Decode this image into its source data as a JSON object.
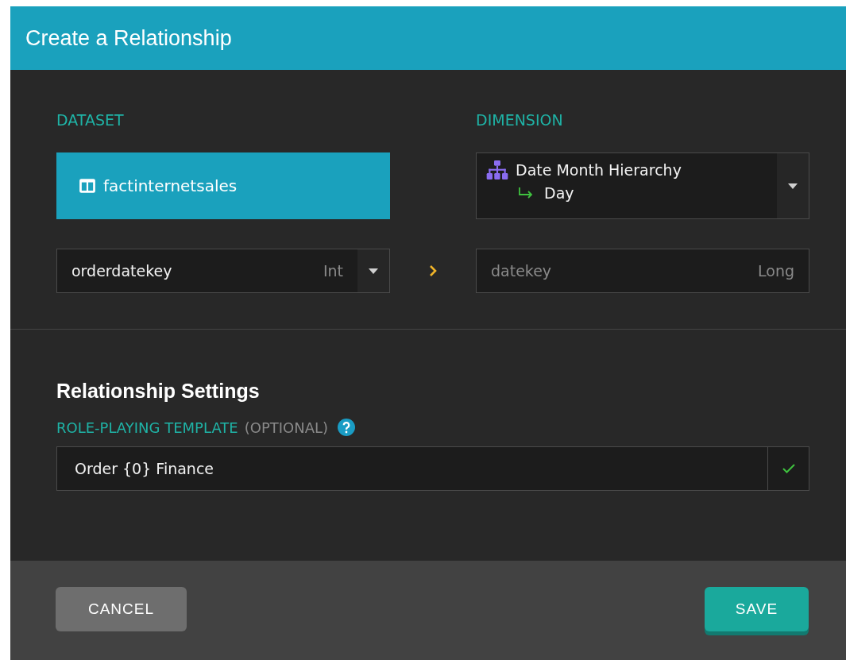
{
  "window": {
    "title": "Create a Relationship"
  },
  "dataset": {
    "label": "DATASET",
    "name": "factinternetsales"
  },
  "dimension": {
    "label": "DIMENSION",
    "hierarchy": "Date Month Hierarchy",
    "level": "Day"
  },
  "source_column": {
    "name": "orderdatekey",
    "type": "Int"
  },
  "target_column": {
    "name": "datekey",
    "type": "Long",
    "disabled": true
  },
  "settings": {
    "heading": "Relationship Settings",
    "template_label": "ROLE-PLAYING TEMPLATE",
    "template_note": "(OPTIONAL)",
    "template_value": "Order {0} Finance",
    "valid": true
  },
  "buttons": [
    {
      "label": "CANCEL",
      "kind": "secondary"
    },
    {
      "label": "SAVE",
      "kind": "primary"
    }
  ]
}
